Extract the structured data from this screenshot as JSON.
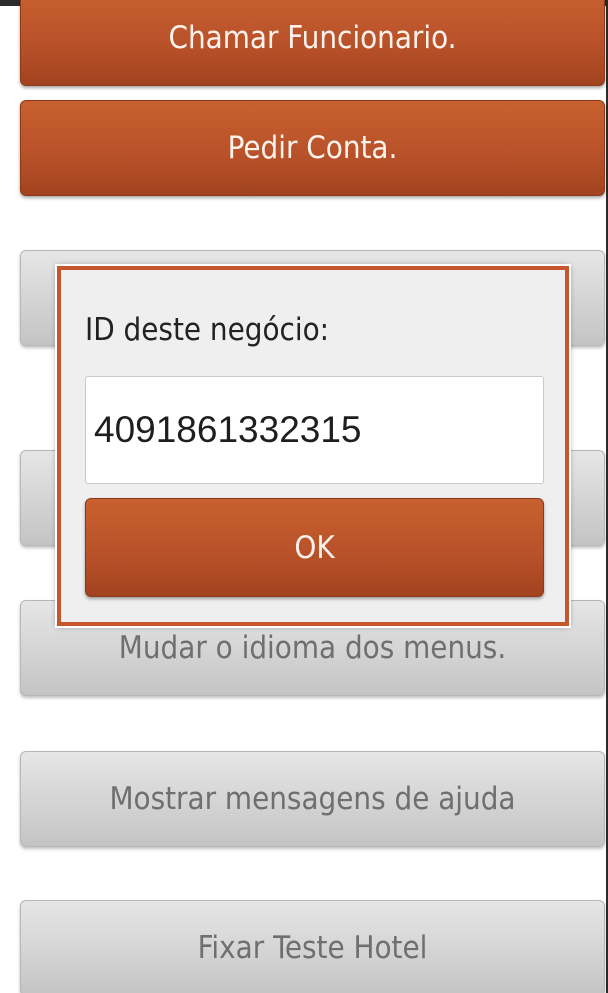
{
  "menu": {
    "chamar_funcionario": "Chamar Funcionario.",
    "pedir_conta": "Pedir Conta.",
    "gray_button_1": "",
    "gray_button_2": "",
    "mudar_idioma": "Mudar o idioma dos menus.",
    "mostrar_ajuda": "Mostrar mensagens de ajuda",
    "fixar_teste_hotel": "Fixar Teste Hotel"
  },
  "dialog": {
    "title": "ID deste negócio:",
    "input_value": "4091861332315",
    "ok_label": "OK"
  },
  "colors": {
    "accent": "#b9522a",
    "accent_border": "#c6562c",
    "button_gray": "#d2d2d2",
    "button_gray_text": "#6f6f6f"
  }
}
